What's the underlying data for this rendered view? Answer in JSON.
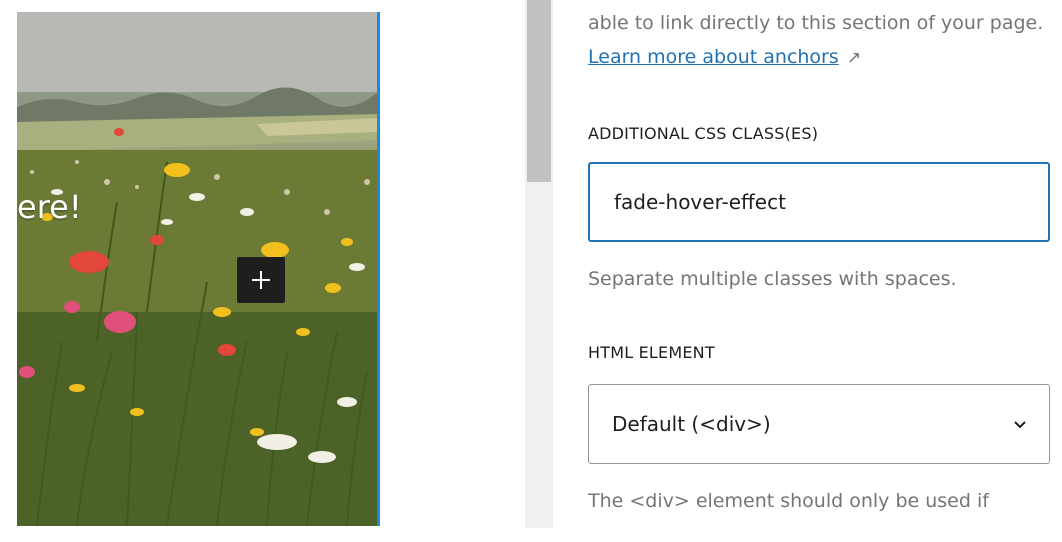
{
  "canvas": {
    "cover_text": "ere!",
    "inserter_label": "+"
  },
  "sidebar": {
    "anchor_help_text": "able to link directly to this section of your page.",
    "anchor_link_label": "Learn more about anchors",
    "external_icon": "↗",
    "css_class_label": "ADDITIONAL CSS CLASS(ES)",
    "css_class_value": "fade-hover-effect",
    "css_class_help": "Separate multiple classes with spaces.",
    "html_element_label": "HTML ELEMENT",
    "html_element_selected": "Default (<div>)",
    "html_element_help": "The <div> element should only be used if"
  },
  "colors": {
    "accent": "#2271b1",
    "selection_border": "#1e88e5",
    "help_text": "#757575"
  },
  "icons": [
    "plus-icon",
    "external-link-icon",
    "chevron-down-icon"
  ]
}
